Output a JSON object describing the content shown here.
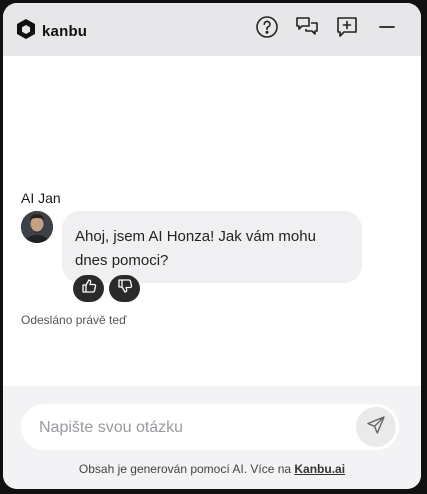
{
  "header": {
    "brand_name": "kanbu",
    "icons": [
      "help-icon",
      "conversations-icon",
      "new-chat-icon",
      "minimize-icon"
    ]
  },
  "chat": {
    "author": "AI Jan",
    "message": "Ahoj, jsem AI Honza! Jak vám mohu dnes pomoci?",
    "status": "Odesláno právě teď"
  },
  "composer": {
    "placeholder": "Napište svou otázku"
  },
  "disclaimer": {
    "text": "Obsah je generován pomocí AI. Více na ",
    "link": "Kanbu.ai"
  },
  "colors": {
    "background": "#f2d56a",
    "header": "#e7e7e9",
    "bubble": "#f0f0f2",
    "reaction_button": "#2a2a2a"
  }
}
